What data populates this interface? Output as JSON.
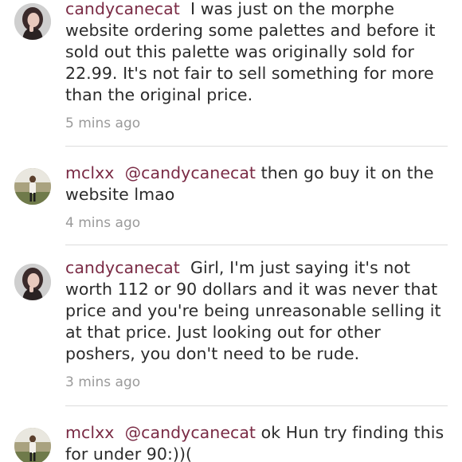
{
  "comments": [
    {
      "username": "candycanecat",
      "mention": "",
      "text": "I was just on the morphe website ordering some palettes and before it sold out this palette was originally sold for 22.99. It's not fair to sell something for more than the original price.",
      "time": "5 mins ago",
      "avatar": "candycanecat-avatar"
    },
    {
      "username": "mclxx",
      "mention": "@candycanecat",
      "text": "then go buy it on the website lmao",
      "time": "4 mins ago",
      "avatar": "mclxx-avatar"
    },
    {
      "username": "candycanecat",
      "mention": "",
      "text": "Girl,  I'm just saying it's not worth 112 or 90 dollars and it was never that price and you're being unreasonable selling it at that price. Just looking out for other poshers, you don't need to be rude.",
      "time": "3 mins ago",
      "avatar": "candycanecat-avatar"
    },
    {
      "username": "mclxx",
      "mention": "@candycanecat",
      "text": "ok Hun try finding this for under 90:))(",
      "time": "",
      "avatar": "mclxx-avatar"
    }
  ],
  "colors": {
    "username": "#7a2b45",
    "text": "#2b2b2b",
    "timestamp": "#9a9a9a",
    "divider": "#dcdcdc"
  }
}
